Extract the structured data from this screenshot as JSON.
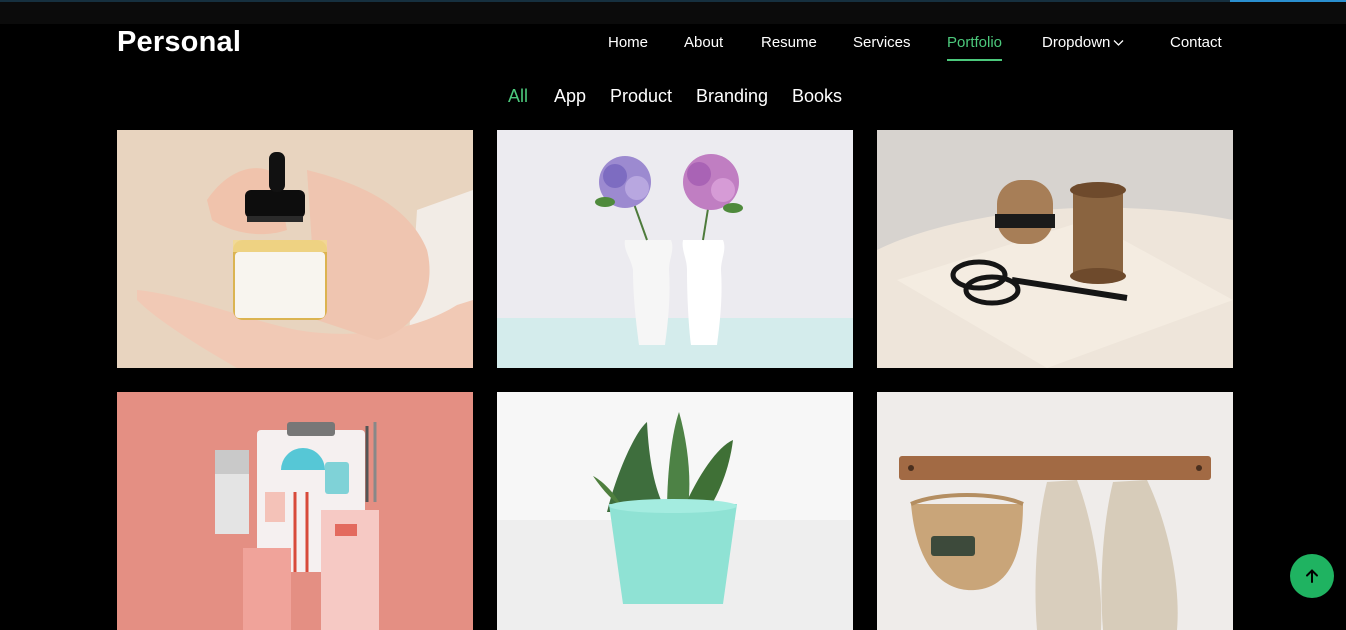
{
  "brand": {
    "title": "Personal"
  },
  "nav": {
    "items": [
      {
        "label": "Home"
      },
      {
        "label": "About"
      },
      {
        "label": "Resume"
      },
      {
        "label": "Services"
      },
      {
        "label": "Portfolio",
        "active": true
      },
      {
        "label": "Dropdown",
        "icon": "chevron-down-icon"
      },
      {
        "label": "Contact"
      }
    ]
  },
  "portfolio": {
    "filters": [
      {
        "label": "All",
        "active": true
      },
      {
        "label": "App"
      },
      {
        "label": "Product"
      },
      {
        "label": "Branding"
      },
      {
        "label": "Books"
      }
    ],
    "items": [
      {
        "image": "hand-holding-dropper-bottle-image"
      },
      {
        "image": "white-vases-with-hydrangeas-image"
      },
      {
        "image": "twine-spools-scissors-book-image"
      },
      {
        "image": "stationery-flatlay-pink-image"
      },
      {
        "image": "succulent-in-mint-pot-image"
      },
      {
        "image": "towels-and-basket-on-hooks-image"
      }
    ]
  },
  "back_to_top": {
    "icon": "arrow-up-icon"
  },
  "colors": {
    "accent": "#4cc97c",
    "background": "#000000",
    "button": "#1fb361"
  }
}
